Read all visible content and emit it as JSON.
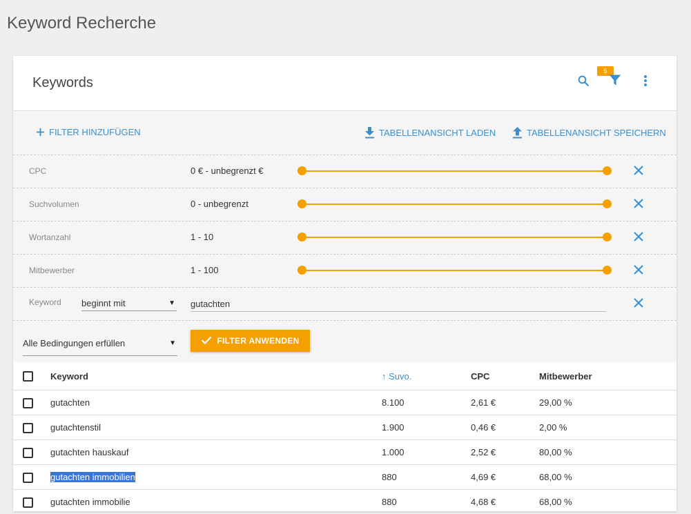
{
  "page": {
    "title": "Keyword Recherche"
  },
  "card": {
    "title": "Keywords",
    "filter_count": "5"
  },
  "toolbar": {
    "add_filter": "FILTER HINZUFÜGEN",
    "load_view": "TABELLENANSICHT LADEN",
    "save_view": "TABELLENANSICHT SPEICHERN"
  },
  "filters": [
    {
      "label": "CPC",
      "value": "0 € - unbegrenzt €",
      "range": [
        0,
        1
      ]
    },
    {
      "label": "Suchvolumen",
      "value": "0 - unbegrenzt",
      "range": [
        0,
        1
      ]
    },
    {
      "label": "Wortanzahl",
      "value": "1 - 10",
      "range": [
        0,
        1
      ]
    },
    {
      "label": "Mitbewerber",
      "value": "1 - 100",
      "range": [
        0,
        1
      ]
    }
  ],
  "keyword_filter": {
    "label": "Keyword",
    "operator": "beginnt mit",
    "value": "gutachten"
  },
  "conditions": {
    "selected": "Alle Bedingungen erfüllen"
  },
  "apply_label": "FILTER ANWENDEN",
  "table": {
    "columns": {
      "keyword": "Keyword",
      "suvo": "Suvo.",
      "cpc": "CPC",
      "competitors": "Mitbewerber"
    },
    "rows": [
      {
        "keyword": "gutachten",
        "suvo": "8.100",
        "cpc": "2,61 €",
        "competitors": "29,00 %"
      },
      {
        "keyword": "gutachtenstil",
        "suvo": "1.900",
        "cpc": "0,46 €",
        "competitors": "2,00 %"
      },
      {
        "keyword": "gutachten hauskauf",
        "suvo": "1.000",
        "cpc": "2,52 €",
        "competitors": "80,00 %"
      },
      {
        "keyword": "gutachten immobilien",
        "suvo": "880",
        "cpc": "4,69 €",
        "competitors": "68,00 %"
      },
      {
        "keyword": "gutachten immobilie",
        "suvo": "880",
        "cpc": "4,68 €",
        "competitors": "68,00 %"
      }
    ]
  },
  "colors": {
    "accent": "#f5a000",
    "link": "#3a8fd0",
    "selection": "#3875d7"
  }
}
